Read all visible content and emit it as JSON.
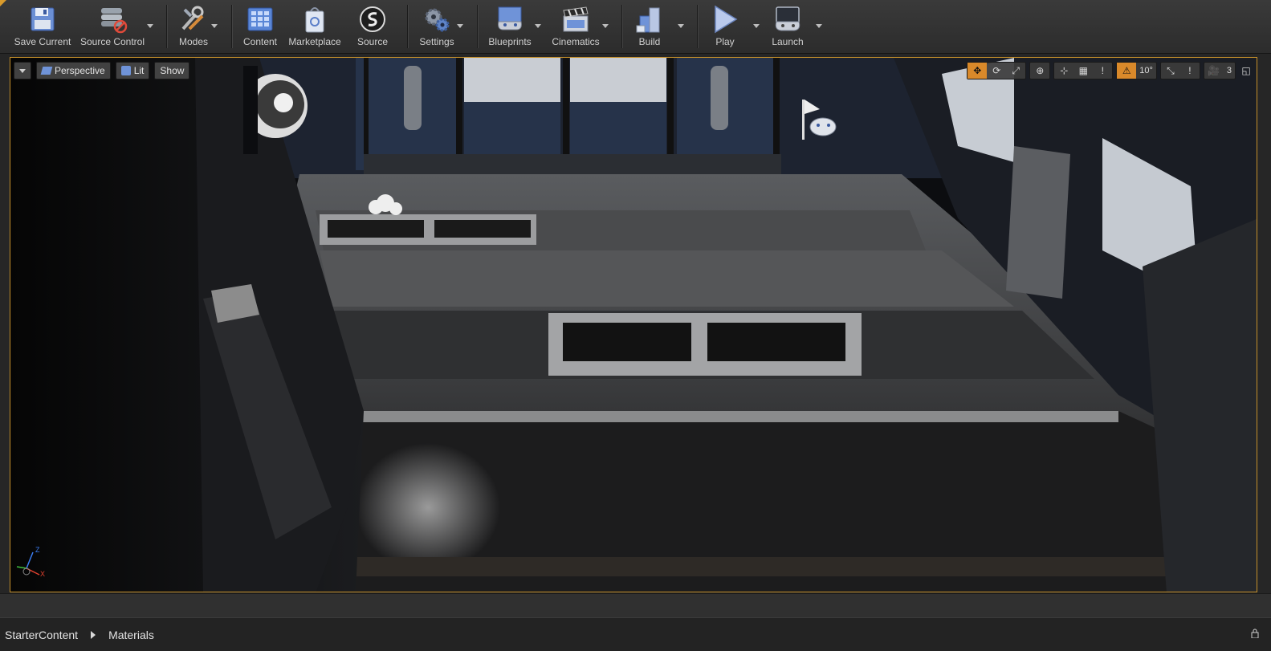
{
  "toolbar": {
    "buttons": [
      {
        "label": "Save Current",
        "icon": "floppy-disk-icon"
      },
      {
        "label": "Source Control",
        "icon": "source-control-icon"
      },
      {
        "label": "Modes",
        "icon": "modes-tools-icon"
      },
      {
        "label": "Content",
        "icon": "content-grid-icon"
      },
      {
        "label": "Marketplace",
        "icon": "marketplace-bag-icon"
      },
      {
        "label": "Source",
        "icon": "source-logo-icon"
      },
      {
        "label": "Settings",
        "icon": "settings-gears-icon"
      },
      {
        "label": "Blueprints",
        "icon": "blueprints-gamepad-icon"
      },
      {
        "label": "Cinematics",
        "icon": "clapperboard-icon"
      },
      {
        "label": "Build",
        "icon": "build-blocks-icon"
      },
      {
        "label": "Play",
        "icon": "play-icon"
      },
      {
        "label": "Launch",
        "icon": "launch-console-icon"
      }
    ]
  },
  "viewport": {
    "perspective_label": "Perspective",
    "lit_label": "Lit",
    "show_label": "Show",
    "rotation_snap": "10°",
    "camera_speed": "3",
    "axis_labels": {
      "z": "Z",
      "x": "X"
    },
    "accent_color": "#d9892a",
    "border_color": "#c48f2a"
  },
  "breadcrumb": {
    "items": [
      "StarterContent",
      "Materials"
    ]
  }
}
